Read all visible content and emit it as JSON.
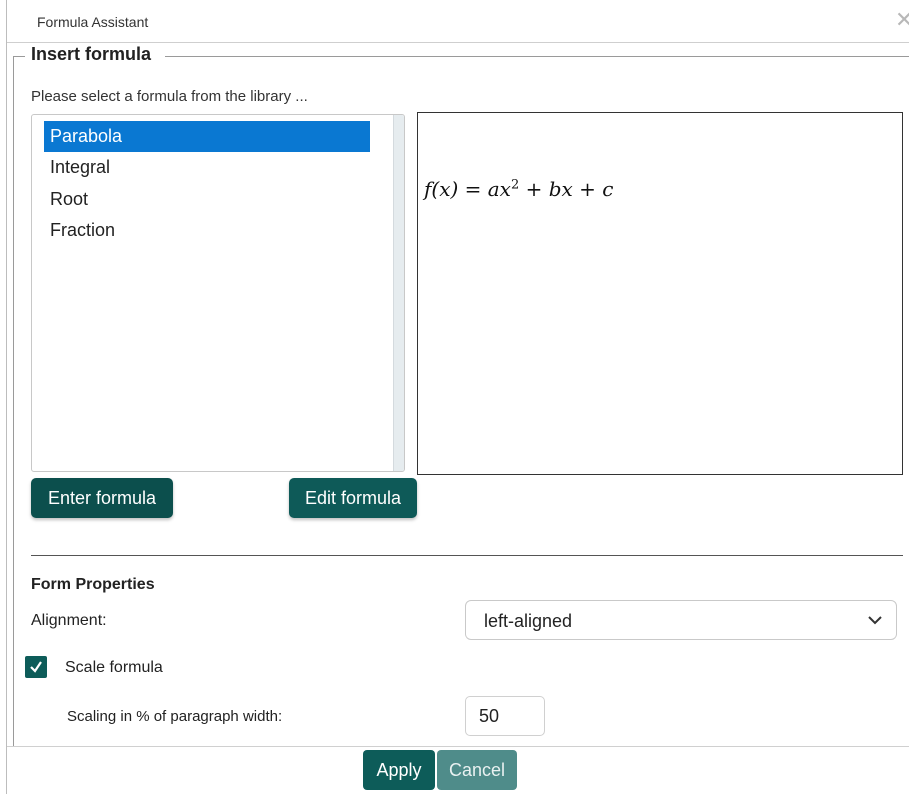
{
  "window": {
    "title": "Formula Assistant",
    "close_icon": "close-icon"
  },
  "insert": {
    "legend": "Insert formula",
    "instructions": "Please select a formula from the library ...",
    "items": [
      {
        "label": "Parabola",
        "selected": true
      },
      {
        "label": "Integral",
        "selected": false
      },
      {
        "label": "Root",
        "selected": false
      },
      {
        "label": "Fraction",
        "selected": false
      }
    ],
    "preview_formula": {
      "lhs": "f(x) = ax",
      "exponent": "2",
      "rhs": " + bx + c"
    },
    "enter_button": "Enter formula",
    "edit_button": "Edit formula"
  },
  "properties": {
    "title": "Form Properties",
    "alignment_label": "Alignment:",
    "alignment_value": "left-aligned",
    "scale_checked": true,
    "scale_label": "Scale formula",
    "scaling_label": "Scaling in % of paragraph width:",
    "scaling_value": "50"
  },
  "footer": {
    "apply": "Apply",
    "cancel": "Cancel"
  },
  "colors": {
    "accent": "#0d5c59",
    "selection": "#0a78d2"
  }
}
